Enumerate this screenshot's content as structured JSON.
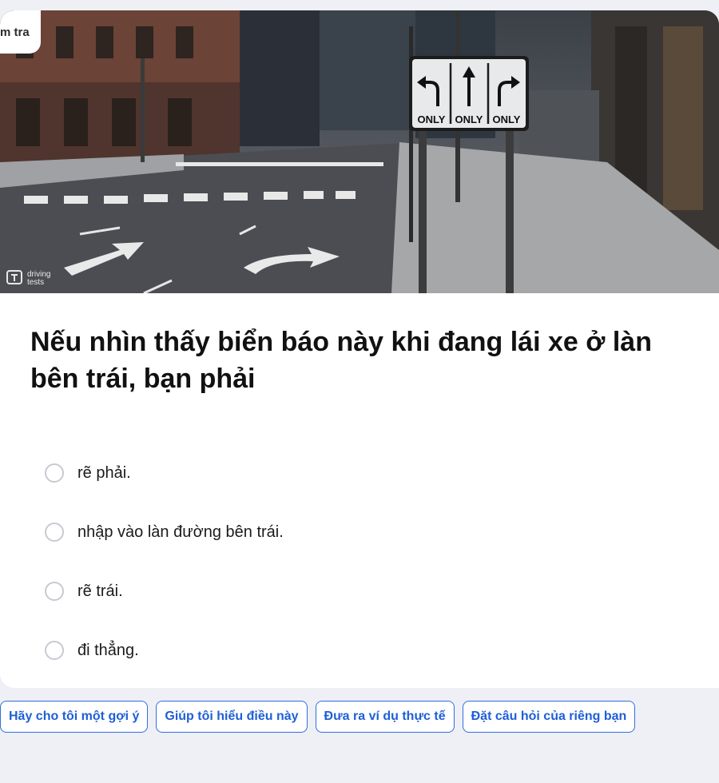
{
  "header": {
    "badge_text": "m tra"
  },
  "image": {
    "watermark_line1": "driving",
    "watermark_line2": "tests",
    "sign_labels": [
      "ONLY",
      "ONLY",
      "ONLY"
    ]
  },
  "question": {
    "text": "Nếu nhìn thấy biển báo này khi đang lái xe ở làn bên trái, bạn phải"
  },
  "options": [
    {
      "label": "rẽ phải."
    },
    {
      "label": "nhập vào làn đường bên trái."
    },
    {
      "label": "rẽ trái."
    },
    {
      "label": "đi thẳng."
    }
  ],
  "suggestions": [
    {
      "label": "Hãy cho tôi một gợi ý"
    },
    {
      "label": "Giúp tôi hiểu điều này"
    },
    {
      "label": "Đưa ra ví dụ thực tế"
    },
    {
      "label": "Đặt câu hỏi của riêng bạn"
    }
  ],
  "colors": {
    "accent": "#2f6fe0",
    "page_background": "#eff0f5",
    "card_background": "#ffffff",
    "radio_border": "#c8cad2"
  }
}
